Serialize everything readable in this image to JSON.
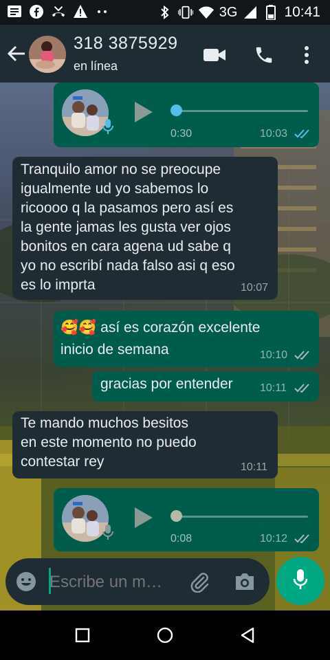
{
  "status_bar": {
    "network": "3G",
    "time": "10:41",
    "left_icons": [
      "message-icon",
      "facebook-icon",
      "missed-call-icon",
      "warning-icon",
      "more-dots-icon"
    ],
    "right_icons": [
      "bluetooth-icon",
      "vibrate-icon",
      "wifi-icon",
      "signal-icon",
      "battery-icon"
    ]
  },
  "header": {
    "contact_name": "318 3875929",
    "status": "en línea",
    "actions": [
      "video-call",
      "voice-call",
      "menu"
    ]
  },
  "messages": [
    {
      "type": "audio",
      "direction": "out",
      "duration": "0:30",
      "time": "10:03",
      "read": true,
      "progress": 0
    },
    {
      "type": "text",
      "direction": "in",
      "lines": [
        "Tranquilo amor no se preocupe",
        "igualmente  ud yo sabemos lo",
        "ricoooo q la pasamos pero así es",
        "la gente jamas les gusta ver ojos",
        "bonitos en cara agena ud sabe q",
        "yo no escribí nada falso asi q eso",
        "es lo imprta"
      ],
      "time": "10:07"
    },
    {
      "type": "text",
      "direction": "out",
      "emoji": "🥰🥰",
      "lines": [
        "así es corazón excelente",
        "inicio de semana"
      ],
      "time": "10:10",
      "read": false
    },
    {
      "type": "text",
      "direction": "out",
      "lines": [
        "gracias por entender"
      ],
      "time": "10:11",
      "read": false
    },
    {
      "type": "text",
      "direction": "in",
      "lines": [
        "Te mando muchos  besitos",
        "en este momento  no puedo",
        "contestar rey"
      ],
      "time": "10:11"
    },
    {
      "type": "audio",
      "direction": "out",
      "duration": "0:08",
      "time": "10:12",
      "read": false,
      "progress": 0
    }
  ],
  "composer": {
    "placeholder": "Escribe un m…"
  },
  "colors": {
    "outgoing_bubble": "#005c4b",
    "incoming_bubble": "#202c33",
    "accent": "#00a884",
    "read_ticks": "#53bdeb",
    "header": "#1f2c34"
  }
}
